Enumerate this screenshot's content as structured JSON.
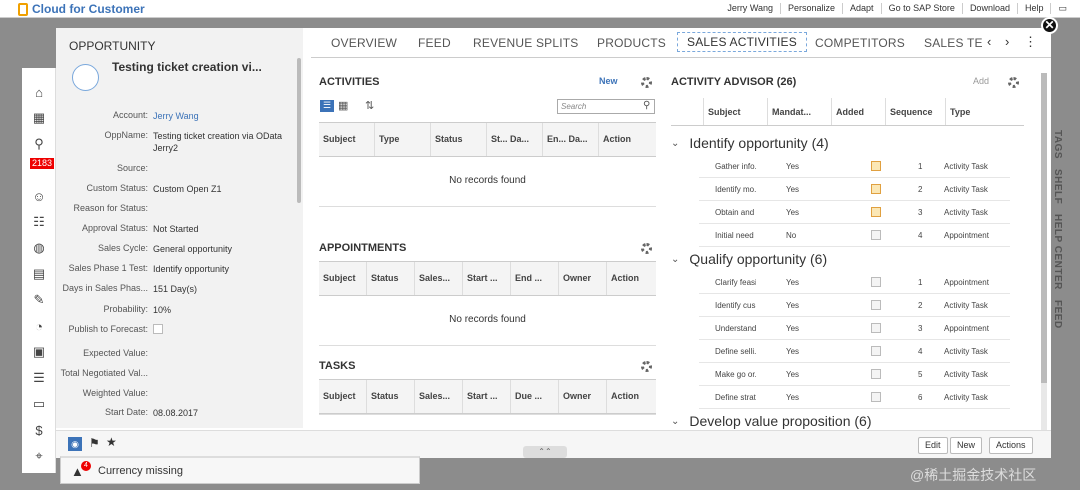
{
  "topbar": {
    "brand": "Cloud for Customer",
    "links": [
      "Jerry Wang",
      "Personalize",
      "Adapt",
      "Go to SAP Store",
      "Download",
      "Help"
    ]
  },
  "leftnav": {
    "badge": "2183"
  },
  "opportunity": {
    "section_title": "OPPORTUNITY",
    "name": "Testing ticket creation vi...",
    "fields": [
      {
        "label": "Account:",
        "value": "Jerry Wang"
      },
      {
        "label": "OppName:",
        "value": "Testing ticket creation via OData Jerry2"
      },
      {
        "label": "Source:",
        "value": ""
      },
      {
        "label": "Custom Status:",
        "value": "Custom Open Z1"
      },
      {
        "label": "Reason for Status:",
        "value": ""
      },
      {
        "label": "Approval Status:",
        "value": "Not Started"
      },
      {
        "label": "Sales Cycle:",
        "value": "General opportunity"
      },
      {
        "label": "Sales Phase 1 Test:",
        "value": "Identify opportunity"
      },
      {
        "label": "Days in Sales Phas...",
        "value": "151 Day(s)"
      },
      {
        "label": "Probability:",
        "value": "10%"
      },
      {
        "label": "Publish to Forecast:",
        "value": ""
      },
      {
        "label": "Expected Value:",
        "value": ""
      },
      {
        "label": "Total Negotiated Val...",
        "value": ""
      },
      {
        "label": "Weighted Value:",
        "value": ""
      },
      {
        "label": "Start Date:",
        "value": "08.08.2017"
      }
    ]
  },
  "tabs": [
    "OVERVIEW",
    "FEED",
    "REVENUE SPLITS",
    "PRODUCTS",
    "SALES ACTIVITIES",
    "COMPETITORS",
    "SALES TE"
  ],
  "activities": {
    "title": "ACTIVITIES",
    "new_label": "New",
    "search_placeholder": "Search",
    "columns": [
      "Subject",
      "Type",
      "Status",
      "St... Da...",
      "En... Da...",
      "Action"
    ],
    "empty": "No records found"
  },
  "appointments": {
    "title": "APPOINTMENTS",
    "columns": [
      "Subject",
      "Status",
      "Sales...",
      "Start ...",
      "End ...",
      "Owner",
      "Action"
    ],
    "empty": "No records found"
  },
  "tasks": {
    "title": "TASKS",
    "columns": [
      "Subject",
      "Status",
      "Sales...",
      "Start ...",
      "Due ...",
      "Owner",
      "Action"
    ]
  },
  "advisor": {
    "title": "ACTIVITY ADVISOR (26)",
    "add_label": "Add",
    "columns": [
      "Subject",
      "Mandat...",
      "Added",
      "Sequence",
      "Type"
    ],
    "groups": [
      {
        "name": "Identify opportunity (4)",
        "rows": [
          {
            "subject": "Gather info...",
            "mandatory": "Yes",
            "added": true,
            "seq": "1",
            "type": "Activity Task"
          },
          {
            "subject": "Identify mo...",
            "mandatory": "Yes",
            "added": true,
            "seq": "2",
            "type": "Activity Task"
          },
          {
            "subject": "Obtain and ...",
            "mandatory": "Yes",
            "added": true,
            "seq": "3",
            "type": "Activity Task"
          },
          {
            "subject": "Initial need ...",
            "mandatory": "No",
            "added": false,
            "seq": "4",
            "type": "Appointment"
          }
        ]
      },
      {
        "name": "Qualify opportunity (6)",
        "rows": [
          {
            "subject": "Clarify feasi...",
            "mandatory": "Yes",
            "added": false,
            "seq": "1",
            "type": "Appointment"
          },
          {
            "subject": "Identify cus...",
            "mandatory": "Yes",
            "added": false,
            "seq": "2",
            "type": "Activity Task"
          },
          {
            "subject": "Understand...",
            "mandatory": "Yes",
            "added": false,
            "seq": "3",
            "type": "Appointment"
          },
          {
            "subject": "Define selli...",
            "mandatory": "Yes",
            "added": false,
            "seq": "4",
            "type": "Activity Task"
          },
          {
            "subject": "Make go or...",
            "mandatory": "Yes",
            "added": false,
            "seq": "5",
            "type": "Activity Task"
          },
          {
            "subject": "Define strat...",
            "mandatory": "Yes",
            "added": false,
            "seq": "6",
            "type": "Activity Task"
          }
        ]
      },
      {
        "name": "Develop value proposition (6)",
        "rows": []
      }
    ]
  },
  "sidebar_right": [
    "TAGS",
    "SHELF",
    "HELP CENTER",
    "FEED"
  ],
  "toolbar": {
    "edit": "Edit",
    "new": "New",
    "actions": "Actions"
  },
  "message": {
    "count": "4",
    "text": "Currency missing"
  },
  "watermark": "@稀土掘金技术社区"
}
